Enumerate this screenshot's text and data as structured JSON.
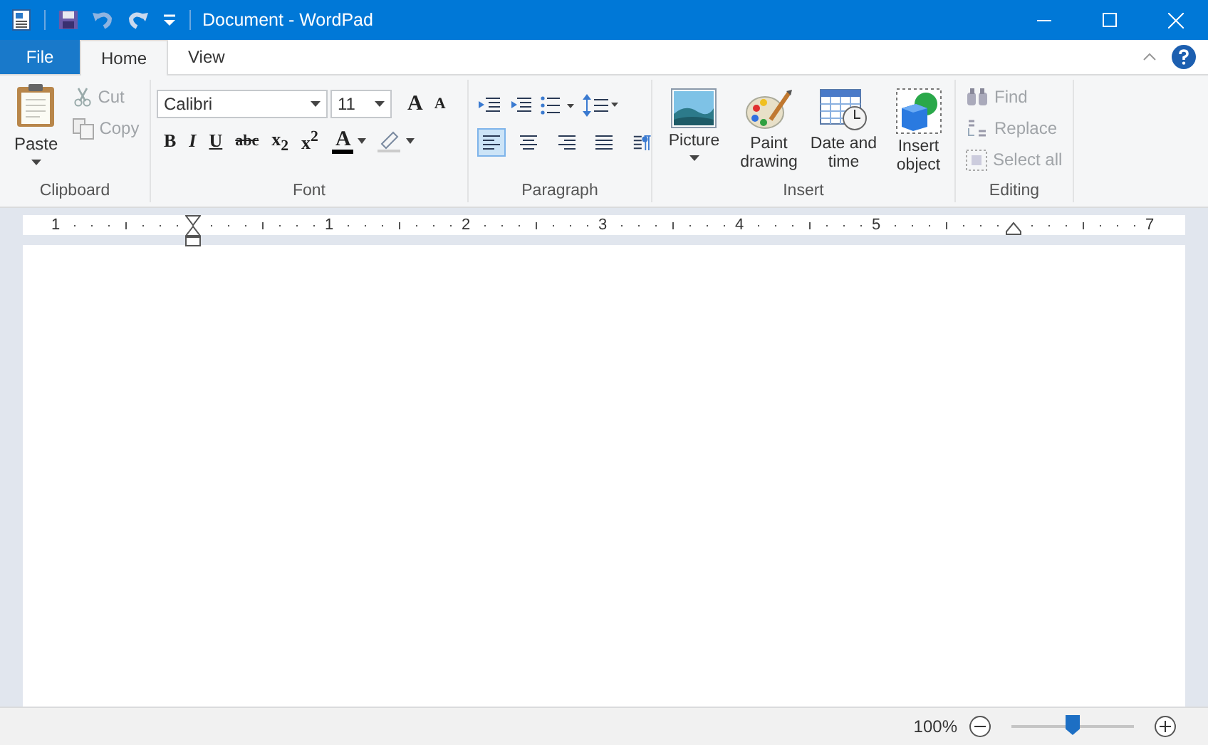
{
  "window": {
    "title": "Document - WordPad"
  },
  "tabs": [
    {
      "label": "File",
      "kind": "file",
      "selected": false
    },
    {
      "label": "Home",
      "kind": "tab",
      "selected": true
    },
    {
      "label": "View",
      "kind": "tab",
      "selected": false
    }
  ],
  "ribbon": {
    "clipboard": {
      "label": "Clipboard",
      "paste": "Paste",
      "items": [
        {
          "label": "Cut",
          "kind": "cut",
          "disabled": true
        },
        {
          "label": "Copy",
          "kind": "copy",
          "disabled": true
        }
      ]
    },
    "font": {
      "label": "Font",
      "font_name": "Calibri",
      "font_size": "11",
      "grow": "A",
      "shrink": "A",
      "format_buttons": [
        {
          "glyph": "B",
          "kind": "bold"
        },
        {
          "glyph": "I",
          "kind": "italic"
        },
        {
          "glyph": "U",
          "kind": "underline"
        },
        {
          "glyph": "abc",
          "kind": "strike"
        },
        {
          "glyph": "x$_{2}$",
          "kind": "sub"
        },
        {
          "glyph": "x$^{2}$",
          "kind": "sup"
        }
      ],
      "color_glyph": "A"
    },
    "paragraph": {
      "label": "Paragraph",
      "align": [
        {
          "kind": "left",
          "selected": true
        },
        {
          "kind": "center",
          "selected": false
        },
        {
          "kind": "right",
          "selected": false
        },
        {
          "kind": "justify",
          "selected": false
        }
      ]
    },
    "insert": {
      "label": "Insert",
      "buttons": [
        {
          "label": "Picture",
          "kind": "picture",
          "dropdown": true
        },
        {
          "label": "Paint drawing",
          "kind": "paint",
          "dropdown": false
        },
        {
          "label": "Date and time",
          "kind": "date",
          "dropdown": false
        },
        {
          "label": "Insert object",
          "kind": "object",
          "dropdown": false
        }
      ]
    },
    "editing": {
      "label": "Editing",
      "items": [
        {
          "label": "Find",
          "kind": "find",
          "disabled": true
        },
        {
          "label": "Replace",
          "kind": "replace",
          "disabled": true
        },
        {
          "label": "Select all",
          "kind": "select",
          "disabled": true
        }
      ]
    }
  },
  "ruler": {
    "labels": [
      "1",
      "1",
      "2",
      "3",
      "4",
      "5",
      "7"
    ]
  },
  "status_bar": {
    "zoom": "100%",
    "level": 0.5
  }
}
